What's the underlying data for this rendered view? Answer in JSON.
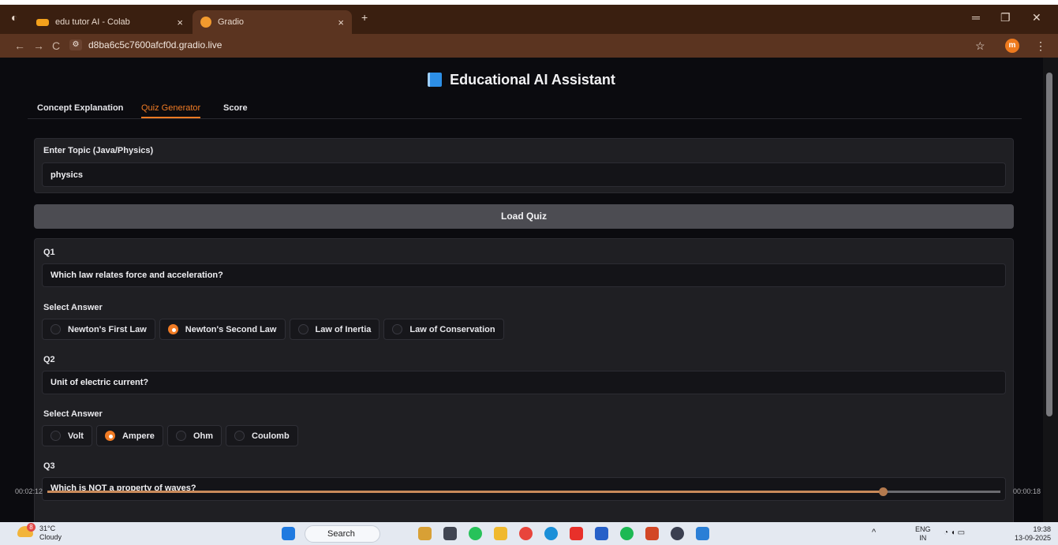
{
  "browser": {
    "tabs": [
      {
        "label": "edu tutor AI - Colab",
        "active": false
      },
      {
        "label": "Gradio",
        "active": true
      }
    ],
    "new_tab": "+",
    "url": "d8ba6c5c7600afcf0d.gradio.live",
    "profile_initial": "m"
  },
  "app": {
    "title": "Educational AI Assistant",
    "tabs": [
      "Concept Explanation",
      "Quiz Generator",
      "Score"
    ],
    "active_tab": "Quiz Generator",
    "topic_label": "Enter Topic (Java/Physics)",
    "topic_value": "physics",
    "load_button": "Load Quiz",
    "answer_label": "Select Answer",
    "questions": [
      {
        "label": "Q1",
        "text": "Which law relates force and acceleration?",
        "options": [
          "Newton's First Law",
          "Newton's Second Law",
          "Law of Inertia",
          "Law of Conservation"
        ],
        "selected": "Newton's Second Law"
      },
      {
        "label": "Q2",
        "text": "Unit of electric current?",
        "options": [
          "Volt",
          "Ampere",
          "Ohm",
          "Coulomb"
        ],
        "selected": "Ampere"
      },
      {
        "label": "Q3",
        "text": "Which is NOT a property of waves?"
      }
    ]
  },
  "video": {
    "elapsed": "00:02:12",
    "remaining": "00:00:18",
    "progress": 0.877
  },
  "taskbar": {
    "weather_temp": "31°C",
    "weather_desc": "Cloudy",
    "weather_badge": "8",
    "search_label": "Search",
    "lang_top": "ENG",
    "lang_bottom": "IN",
    "time": "19:38",
    "date": "13-09-2025"
  },
  "colors": {
    "accent": "#f07b24",
    "tabbar": "#3a1f10",
    "addressbar": "#5b3420"
  }
}
